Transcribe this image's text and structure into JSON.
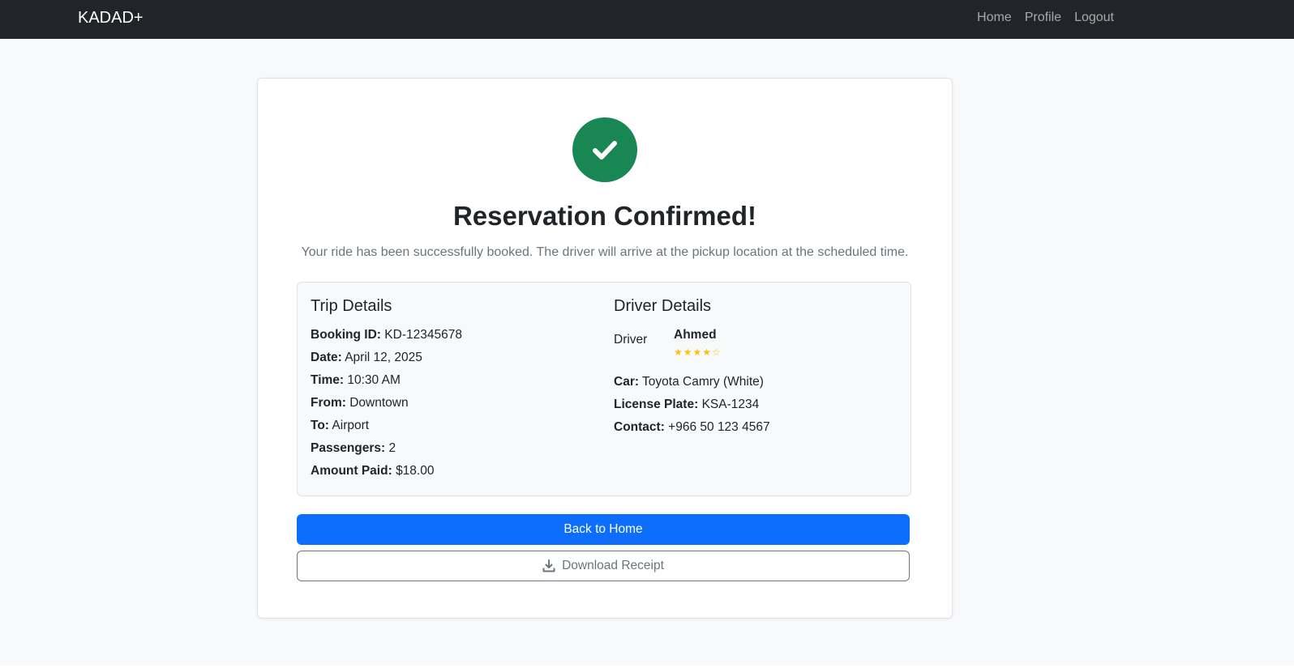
{
  "navbar": {
    "brand": "KADAD+",
    "links": [
      "Home",
      "Profile",
      "Logout"
    ]
  },
  "confirmation": {
    "title": "Reservation Confirmed!",
    "message": "Your ride has been successfully booked. The driver will arrive at the pickup location at the scheduled time."
  },
  "trip": {
    "heading": "Trip Details",
    "fields": [
      {
        "label": "Booking ID:",
        "value": "KD-12345678"
      },
      {
        "label": "Date:",
        "value": "April 12, 2025"
      },
      {
        "label": "Time:",
        "value": "10:30 AM"
      },
      {
        "label": "From:",
        "value": "Downtown"
      },
      {
        "label": "To:",
        "value": "Airport"
      },
      {
        "label": "Passengers:",
        "value": "2"
      },
      {
        "label": "Amount Paid:",
        "value": "$18.00"
      }
    ]
  },
  "driver": {
    "heading": "Driver Details",
    "image_alt": "Driver",
    "name": "Ahmed",
    "rating": 4,
    "rating_max": 5,
    "stars": "★★★★☆",
    "fields": [
      {
        "label": "Car:",
        "value": "Toyota Camry (White)"
      },
      {
        "label": "License Plate:",
        "value": "KSA-1234"
      },
      {
        "label": "Contact:",
        "value": "+966 50 123 4567"
      }
    ]
  },
  "actions": {
    "back_home": "Back to Home",
    "download_receipt": "Download Receipt"
  },
  "colors": {
    "navbar": "#212529",
    "success": "#198754",
    "primary": "#0d6efd",
    "secondary": "#6c757d",
    "star": "#ffc107"
  },
  "icons": {
    "success": "check-icon",
    "download": "download-icon"
  }
}
